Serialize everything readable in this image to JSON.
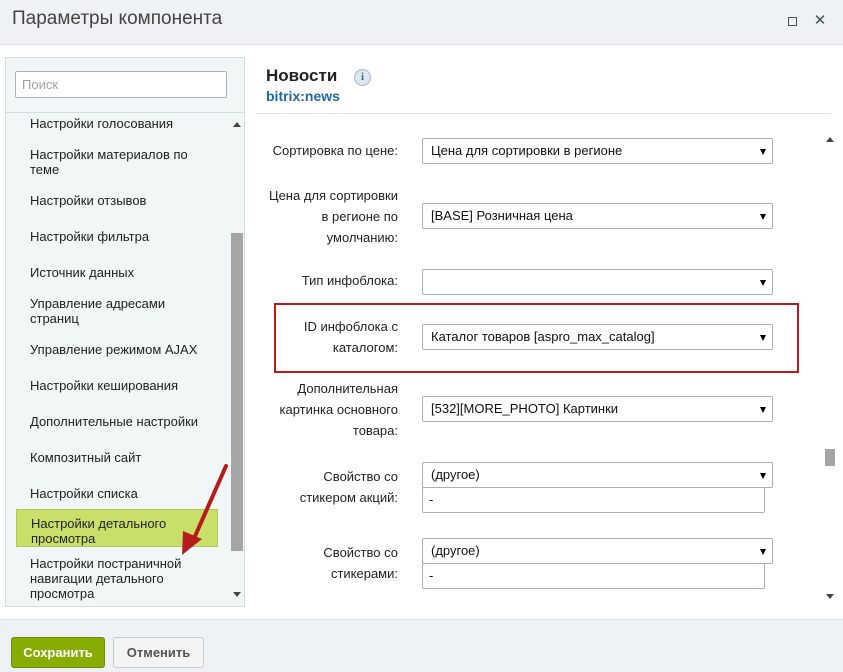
{
  "window": {
    "title": "Параметры компонента",
    "maximize_icon": "maximize-icon",
    "close_icon": "close-icon",
    "close_glyph": "✕"
  },
  "sidebar": {
    "search_placeholder": "Поиск",
    "active_color": "#c8e06a",
    "items": [
      {
        "label": "Настройки голосования"
      },
      {
        "label": "Настройки материалов по теме"
      },
      {
        "label": "Настройки отзывов"
      },
      {
        "label": "Настройки фильтра"
      },
      {
        "label": "Источник данных"
      },
      {
        "label": "Управление адресами страниц"
      },
      {
        "label": "Управление режимом AJAX"
      },
      {
        "label": "Настройки кеширования"
      },
      {
        "label": "Дополнительные настройки"
      },
      {
        "label": "Композитный сайт"
      },
      {
        "label": "Настройки списка"
      },
      {
        "label": "Настройки детального просмотра",
        "active": true
      },
      {
        "label": "Настройки постраничной навигации детального просмотра"
      }
    ]
  },
  "component": {
    "name": "Новости",
    "code": "bitrix:news",
    "info_icon": "info-icon",
    "info_glyph": "i"
  },
  "params": [
    {
      "label": "Сортировка по цене:",
      "value": "Цена для сортировки в регионе"
    },
    {
      "label_lines": [
        "Цена для сортировки",
        "в регионе по",
        "умолчанию:"
      ],
      "value": "[BASE] Розничная цена"
    },
    {
      "label": "Тип инфоблока:",
      "value": ""
    },
    {
      "label_lines": [
        "ID инфоблока с",
        "каталогом:"
      ],
      "value": "Каталог товаров [aspro_max_catalog]",
      "highlighted": true
    },
    {
      "label_lines": [
        "Дополнительная",
        "картинка основного",
        "товара:"
      ],
      "value": "[532][MORE_PHOTO] Картинки"
    },
    {
      "label_lines": [
        "Свойство со",
        "стикером акций:"
      ],
      "value": "(другое)",
      "text_value": "-"
    },
    {
      "label_lines": [
        "Свойство со",
        "стикерами:"
      ],
      "value": "(другое)",
      "text_value": "-"
    }
  ],
  "highlight_color": "#b71c1c",
  "arrow_color": "#b71c1c",
  "footer": {
    "save_label": "Сохранить",
    "cancel_label": "Отменить",
    "save_color": "#86ad00"
  }
}
